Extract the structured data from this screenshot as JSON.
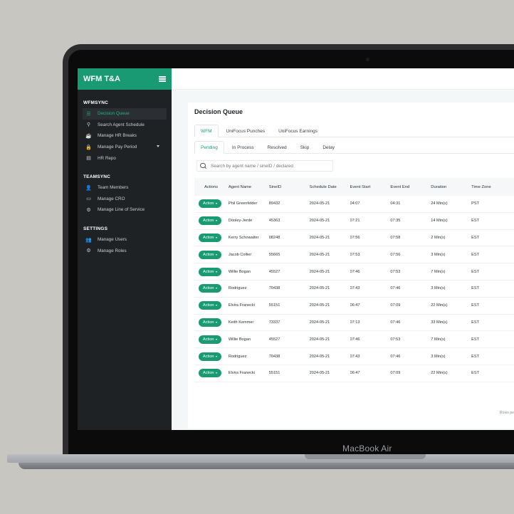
{
  "device": {
    "brand": "MacBook Air"
  },
  "sidebar": {
    "app_title": "WFM T&A",
    "sections": [
      {
        "title": "WFMSYNC",
        "items": [
          {
            "label": "Decision Queue",
            "icon": "list-icon",
            "active": true
          },
          {
            "label": "Search Agent Schedule",
            "icon": "search-icon"
          },
          {
            "label": "Manage HR Breaks",
            "icon": "coffee-icon"
          },
          {
            "label": "Manage Pay Period",
            "icon": "lock-icon",
            "caret": true
          },
          {
            "label": "HR Repo",
            "icon": "file-icon"
          }
        ]
      },
      {
        "title": "TEAMSYNC",
        "items": [
          {
            "label": "Team Members",
            "icon": "user-icon"
          },
          {
            "label": "Manage CRO",
            "icon": "card-icon"
          },
          {
            "label": "Manage Line of Service",
            "icon": "cog-icon"
          }
        ]
      },
      {
        "title": "SETTINGS",
        "items": [
          {
            "label": "Manage Users",
            "icon": "users-icon"
          },
          {
            "label": "Manage Roles",
            "icon": "user-gear-icon"
          }
        ]
      }
    ]
  },
  "main": {
    "title": "Decision Queue",
    "tabs": [
      "WFM",
      "UniFocus Punches",
      "UniFocus Earnings"
    ],
    "subtabs": [
      "Pending",
      "In Process",
      "Resolved",
      "Skip",
      "Delay"
    ],
    "search_placeholder": "Search by agent name / sineID / declared",
    "columns": [
      "Actions",
      "Agent Name",
      "SineID",
      "Schedule Date",
      "Event Start",
      "Event End",
      "Duration",
      "Time Zone"
    ],
    "action_label": "Action",
    "rows": [
      [
        "Phil Greenfelder",
        "89432",
        "2024-05-21",
        "04:07",
        "04:31",
        "24 Min(s)",
        "PST"
      ],
      [
        "Dooley-Jerde",
        "45363",
        "2024-05-21",
        "07:21",
        "07:35",
        "14 Min(s)",
        "EST"
      ],
      [
        "Kerry Schowalter",
        "08248",
        "2024-05-21",
        "07:56",
        "07:58",
        "2 Min(s)",
        "EST"
      ],
      [
        "Jacob Collier",
        "55665",
        "2024-05-21",
        "07:53",
        "07:56",
        "3 Min(s)",
        "EST"
      ],
      [
        "Willie Bogan",
        "45527",
        "2024-05-21",
        "07:46",
        "07:53",
        "7 Min(s)",
        "EST"
      ],
      [
        "Rodriguez",
        "70438",
        "2024-05-21",
        "07:43",
        "07:46",
        "3 Min(s)",
        "EST"
      ],
      [
        "Elvira Franecki",
        "55151",
        "2024-05-21",
        "06:47",
        "07:09",
        "22 Min(s)",
        "EST"
      ],
      [
        "Keith Kemmer",
        "73337",
        "2024-05-21",
        "07:13",
        "07:46",
        "33 Min(s)",
        "EST"
      ],
      [
        "Willie Bogan",
        "45527",
        "2024-05-21",
        "07:46",
        "07:53",
        "7 Min(s)",
        "EST"
      ],
      [
        "Rodriguez",
        "70438",
        "2024-05-21",
        "07:43",
        "07:46",
        "3 Min(s)",
        "EST"
      ],
      [
        "Elvira Franecki",
        "55151",
        "2024-05-21",
        "06:47",
        "07:09",
        "22 Min(s)",
        "EST"
      ]
    ],
    "footer_text": "Rows pe"
  },
  "colors": {
    "accent": "#1a9a73",
    "sidebar_bg": "#1f2225",
    "main_bg": "#f3f7f7"
  }
}
